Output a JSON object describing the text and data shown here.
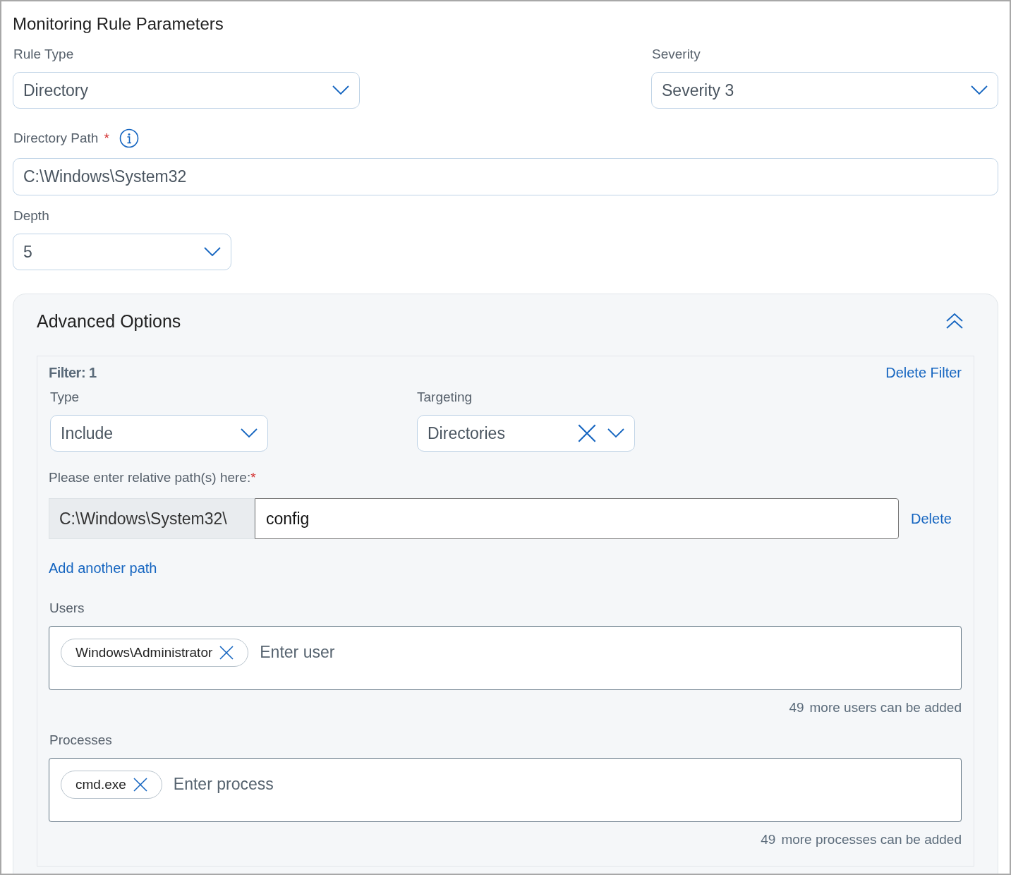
{
  "title": "Monitoring Rule Parameters",
  "rule_type": {
    "label": "Rule Type",
    "value": "Directory"
  },
  "severity": {
    "label": "Severity",
    "value": "Severity 3"
  },
  "directory_path": {
    "label": "Directory Path",
    "required_mark": "*",
    "value": "C:\\Windows\\System32"
  },
  "depth": {
    "label": "Depth",
    "value": "5"
  },
  "advanced_options": {
    "title": "Advanced Options",
    "expanded": true,
    "filters": [
      {
        "title": "Filter: 1",
        "delete_label": "Delete Filter",
        "type": {
          "label": "Type",
          "value": "Include",
          "clearable": false
        },
        "targeting": {
          "label": "Targeting",
          "value": "Directories",
          "clearable": true
        },
        "paths_label": "Please enter relative path(s) here:",
        "paths_required_mark": "*",
        "paths": [
          {
            "prefix": "C:\\Windows\\System32\\",
            "value": "config",
            "delete_label": "Delete"
          }
        ],
        "add_path_label": "Add another path",
        "users": {
          "label": "Users",
          "tags": [
            "Windows\\Administrator"
          ],
          "placeholder": "Enter user",
          "count": "49",
          "count_text": "more users can be added"
        },
        "processes": {
          "label": "Processes",
          "tags": [
            "cmd.exe"
          ],
          "placeholder": "Enter process",
          "count": "49",
          "count_text": "more processes can be added"
        }
      }
    ]
  }
}
